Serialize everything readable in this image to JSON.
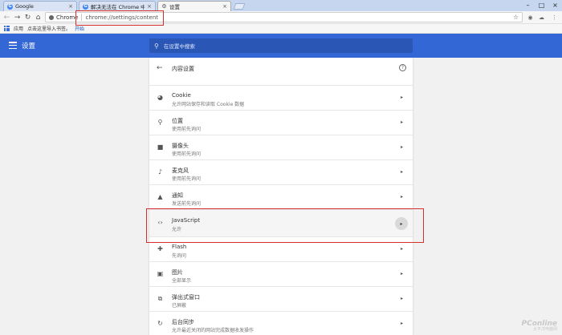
{
  "browser": {
    "tabs": [
      {
        "title": "Google",
        "favicon": "google-favicon"
      },
      {
        "title": "解决无法在 Chrome 中…",
        "favicon": "google-favicon"
      },
      {
        "title": "设置",
        "favicon": "gear-icon"
      }
    ],
    "omnibox": {
      "chip_label": "Chrome",
      "url": "chrome://settings/content"
    },
    "bookmarks": {
      "apps_label": "应用",
      "import_prompt": "点击这里导入书签。",
      "start_link": "开始"
    }
  },
  "settings": {
    "header_title": "设置",
    "search_placeholder": "在设置中搜索",
    "accent": "#3367d6",
    "card_title": "内容设置",
    "items": [
      {
        "label": "Cookie",
        "sub": "允许网站保存和读取 Cookie 数据",
        "icon": "cookie-icon"
      },
      {
        "label": "位置",
        "sub": "使用前先询问",
        "icon": "location-pin-icon"
      },
      {
        "label": "摄像头",
        "sub": "使用前先询问",
        "icon": "camera-icon"
      },
      {
        "label": "麦克风",
        "sub": "使用前先询问",
        "icon": "microphone-icon"
      },
      {
        "label": "通知",
        "sub": "发送前先询问",
        "icon": "bell-icon"
      },
      {
        "label": "JavaScript",
        "sub": "允许",
        "icon": "code-icon"
      },
      {
        "label": "Flash",
        "sub": "先询问",
        "icon": "puzzle-icon"
      },
      {
        "label": "图片",
        "sub": "全部显示",
        "icon": "image-icon"
      },
      {
        "label": "弹出式窗口",
        "sub": "已屏蔽",
        "icon": "popup-icon"
      },
      {
        "label": "后台同步",
        "sub": "允许最近关闭的网站完成数据收发操作",
        "icon": "sync-icon"
      }
    ]
  },
  "watermark": {
    "text": "PConline",
    "sub": "太平洋电脑网"
  }
}
